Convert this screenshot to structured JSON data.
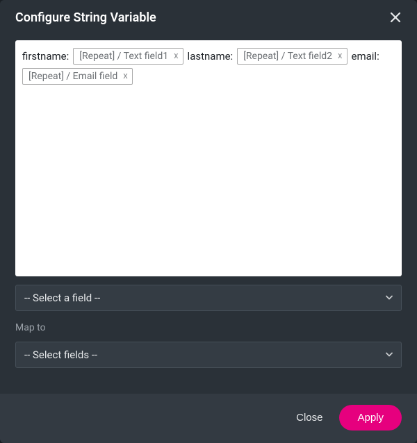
{
  "modal": {
    "title": "Configure String Variable"
  },
  "editor": {
    "entries": [
      {
        "label": "firstname:",
        "token": "[Repeat] / Text field1"
      },
      {
        "label": "lastname:",
        "token": "[Repeat] / Text field2"
      },
      {
        "label": "email:",
        "token": "[Repeat] / Email field"
      }
    ],
    "token_remove_glyph": "x"
  },
  "selects": {
    "field_placeholder": "-- Select a field --",
    "map_to_label": "Map to",
    "map_to_placeholder": "-- Select fields --"
  },
  "footer": {
    "close_label": "Close",
    "apply_label": "Apply"
  }
}
